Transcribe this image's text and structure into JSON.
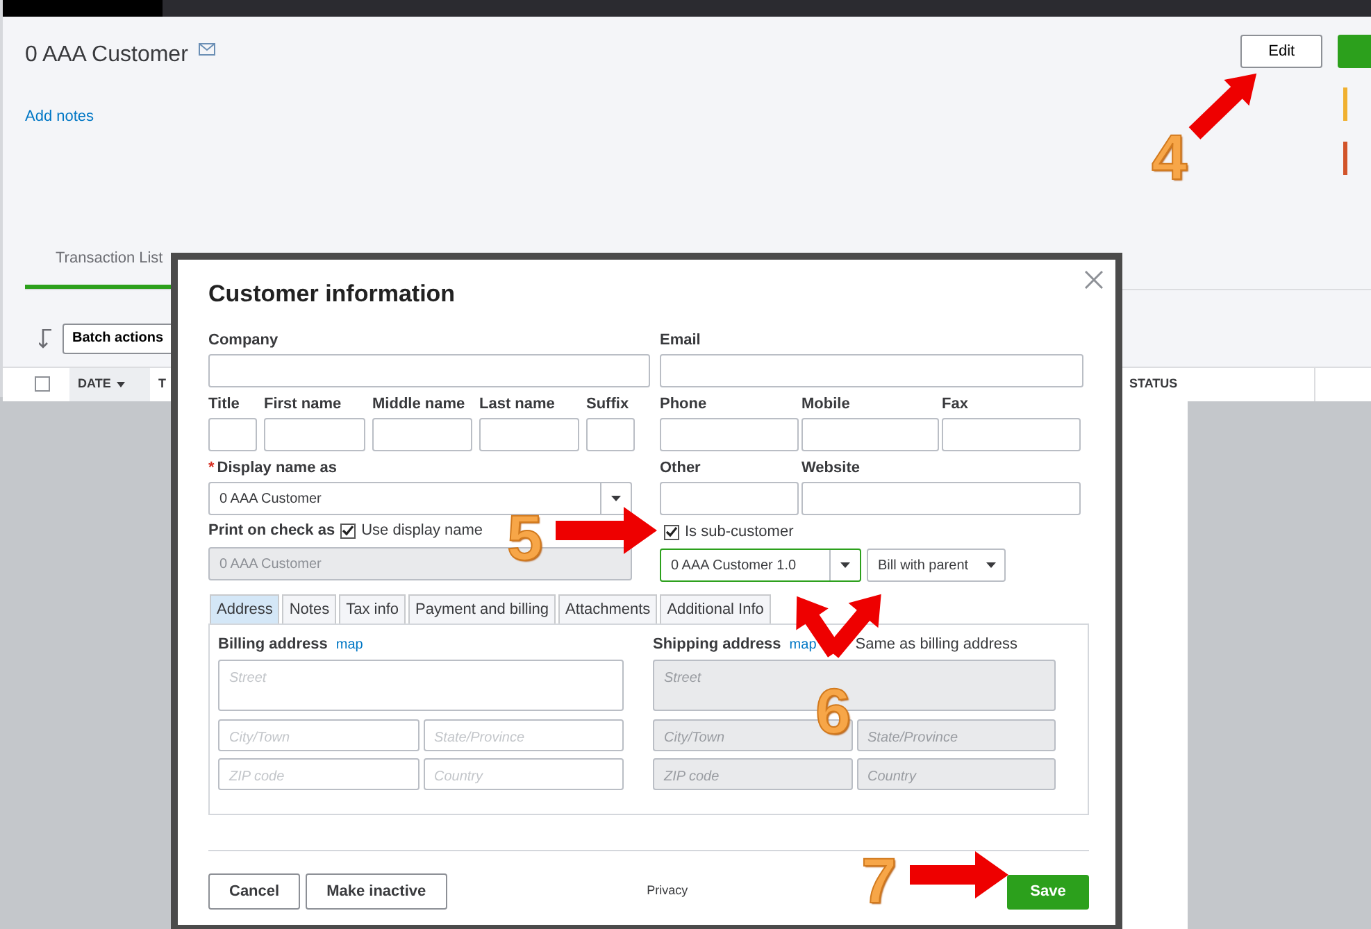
{
  "page": {
    "title": "0 AAA Customer",
    "add_notes": "Add notes",
    "edit_button": "Edit",
    "status_bars": [
      {
        "color": "#f0b030"
      },
      {
        "color": "#d2542a"
      }
    ],
    "tabs": [
      {
        "label": "Transaction List",
        "selected": true
      }
    ],
    "batch_actions": "Batch actions",
    "select_all_checked": false,
    "table_columns": [
      {
        "label": "DATE",
        "sorted": true
      },
      {
        "label": "T",
        "sorted": false
      },
      {
        "label": "STATUS",
        "sorted": false
      }
    ]
  },
  "dialog": {
    "title": "Customer information",
    "company": {
      "label": "Company"
    },
    "email": {
      "label": "Email"
    },
    "name_fields": [
      {
        "label": "Title"
      },
      {
        "label": "First name"
      },
      {
        "label": "Middle name"
      },
      {
        "label": "Last name"
      },
      {
        "label": "Suffix"
      }
    ],
    "contact_fields": [
      {
        "label": "Phone"
      },
      {
        "label": "Mobile"
      },
      {
        "label": "Fax"
      }
    ],
    "other_fields": [
      {
        "label": "Other"
      },
      {
        "label": "Website"
      }
    ],
    "display_name": {
      "required_mark": "*",
      "label": "Display name as",
      "value": "0 AAA Customer"
    },
    "print_on_check": {
      "label": "Print on check as",
      "checkbox_label": "Use display name",
      "checked": true,
      "value": "0 AAA Customer",
      "disabled": true
    },
    "sub_customer": {
      "label": "Is sub-customer",
      "checked": true,
      "parent": "0 AAA Customer 1.0",
      "billing": "Bill with parent"
    },
    "tabs": [
      {
        "label": "Address",
        "selected": true
      },
      {
        "label": "Notes",
        "selected": false
      },
      {
        "label": "Tax info",
        "selected": false
      },
      {
        "label": "Payment and billing",
        "selected": false
      },
      {
        "label": "Attachments",
        "selected": false
      },
      {
        "label": "Additional Info",
        "selected": false
      }
    ],
    "billing_address": {
      "heading": "Billing address",
      "map_link": "map",
      "disabled": false,
      "fields": [
        {
          "placeholder": "Street"
        },
        {
          "placeholder": "City/Town"
        },
        {
          "placeholder": "State/Province"
        },
        {
          "placeholder": "ZIP code"
        },
        {
          "placeholder": "Country"
        }
      ]
    },
    "shipping_address": {
      "heading": "Shipping address",
      "map_link": "map",
      "same_as_billing": "Same as billing address",
      "disabled": true,
      "fields": [
        {
          "placeholder": "Street"
        },
        {
          "placeholder": "City/Town"
        },
        {
          "placeholder": "State/Province"
        },
        {
          "placeholder": "ZIP code"
        },
        {
          "placeholder": "Country"
        }
      ]
    },
    "cancel_button": "Cancel",
    "inactive_button": "Make inactive",
    "privacy": "Privacy",
    "save_button": "Save"
  },
  "annotations": [
    {
      "number": "4"
    },
    {
      "number": "5"
    },
    {
      "number": "6"
    },
    {
      "number": "7"
    }
  ]
}
